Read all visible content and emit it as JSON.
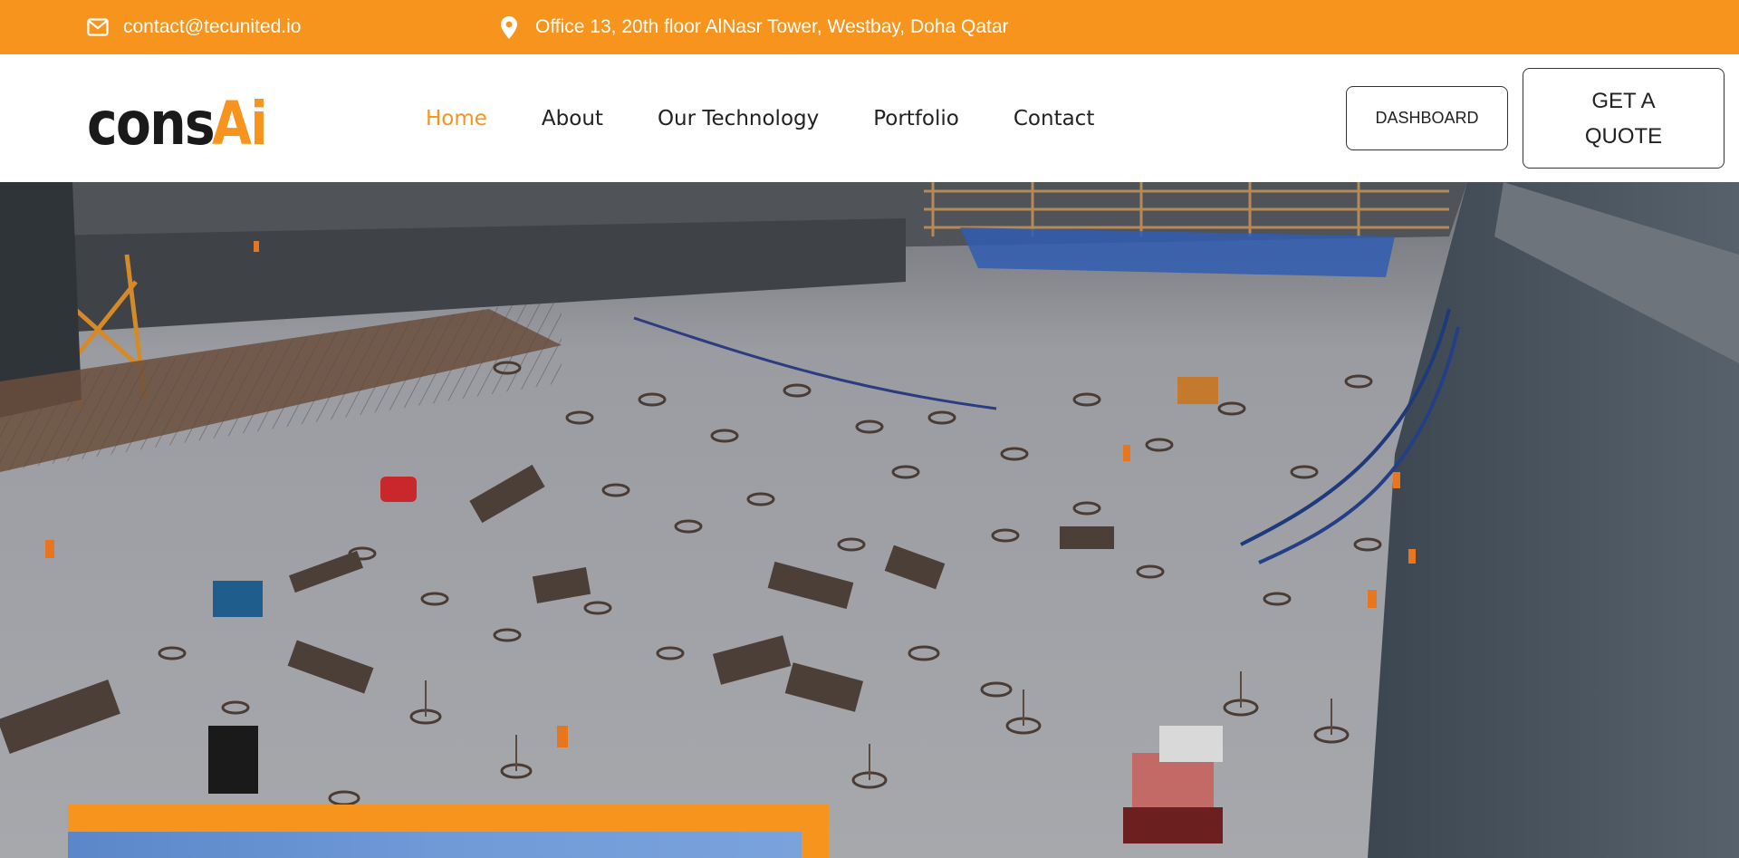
{
  "topbar": {
    "email": "contact@tecunited.io",
    "email_icon": "envelope-icon",
    "address": "Office 13, 20th floor AlNasr Tower, Westbay, Doha Qatar",
    "address_icon": "map-pin-icon"
  },
  "logo": {
    "text_dark": "cons",
    "text_accent": "Ai"
  },
  "nav": {
    "items": [
      {
        "label": "Home",
        "active": true
      },
      {
        "label": "About",
        "active": false
      },
      {
        "label": "Our Technology",
        "active": false
      },
      {
        "label": "Portfolio",
        "active": false
      },
      {
        "label": "Contact",
        "active": false
      }
    ]
  },
  "buttons": {
    "dashboard": "DASHBOARD",
    "quote": "GET A QUOTE"
  },
  "colors": {
    "accent": "#f7941d",
    "text_dark": "#222222",
    "white": "#ffffff"
  },
  "hero": {
    "image": "construction-site-photo"
  }
}
